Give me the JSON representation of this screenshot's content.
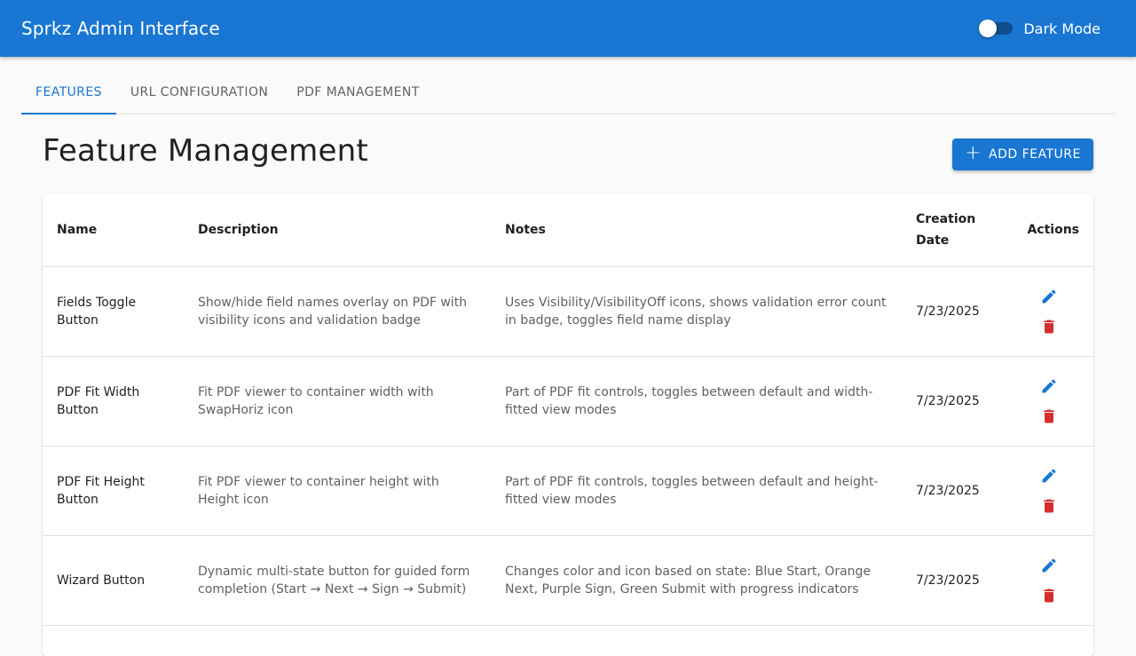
{
  "app": {
    "title": "Sprkz Admin Interface"
  },
  "header": {
    "dark_mode_label": "Dark Mode",
    "dark_mode_on": false
  },
  "tabs": [
    {
      "label": "FEATURES",
      "active": true
    },
    {
      "label": "URL CONFIGURATION",
      "active": false
    },
    {
      "label": "PDF MANAGEMENT",
      "active": false
    }
  ],
  "page": {
    "title": "Feature Management",
    "add_button_label": "ADD FEATURE"
  },
  "table": {
    "headers": {
      "name": "Name",
      "description": "Description",
      "notes": "Notes",
      "creation_date": "Creation Date",
      "actions": "Actions"
    },
    "rows": [
      {
        "name": "Fields Toggle Button",
        "description": "Show/hide field names overlay on PDF with visibility icons and validation badge",
        "notes": "Uses Visibility/VisibilityOff icons, shows validation error count in badge, toggles field name display",
        "date": "7/23/2025"
      },
      {
        "name": "PDF Fit Width Button",
        "description": "Fit PDF viewer to container width with SwapHoriz icon",
        "notes": "Part of PDF fit controls, toggles between default and width-fitted view modes",
        "date": "7/23/2025"
      },
      {
        "name": "PDF Fit Height Button",
        "description": "Fit PDF viewer to container height with Height icon",
        "notes": "Part of PDF fit controls, toggles between default and height-fitted view modes",
        "date": "7/23/2025"
      },
      {
        "name": "Wizard Button",
        "description": "Dynamic multi-state button for guided form completion (Start → Next → Sign → Submit)",
        "notes": "Changes color and icon based on state: Blue Start, Orange Next, Purple Sign, Green Submit with progress indicators",
        "date": "7/23/2025"
      }
    ]
  },
  "colors": {
    "primary": "#1976d2",
    "edit_icon": "#1976d2",
    "delete_icon": "#d32f2f",
    "toggle_track": "#0f4c8c"
  },
  "icons": {
    "edit": "pencil-edit-icon",
    "delete": "trash-delete-icon",
    "add": "plus-icon"
  }
}
